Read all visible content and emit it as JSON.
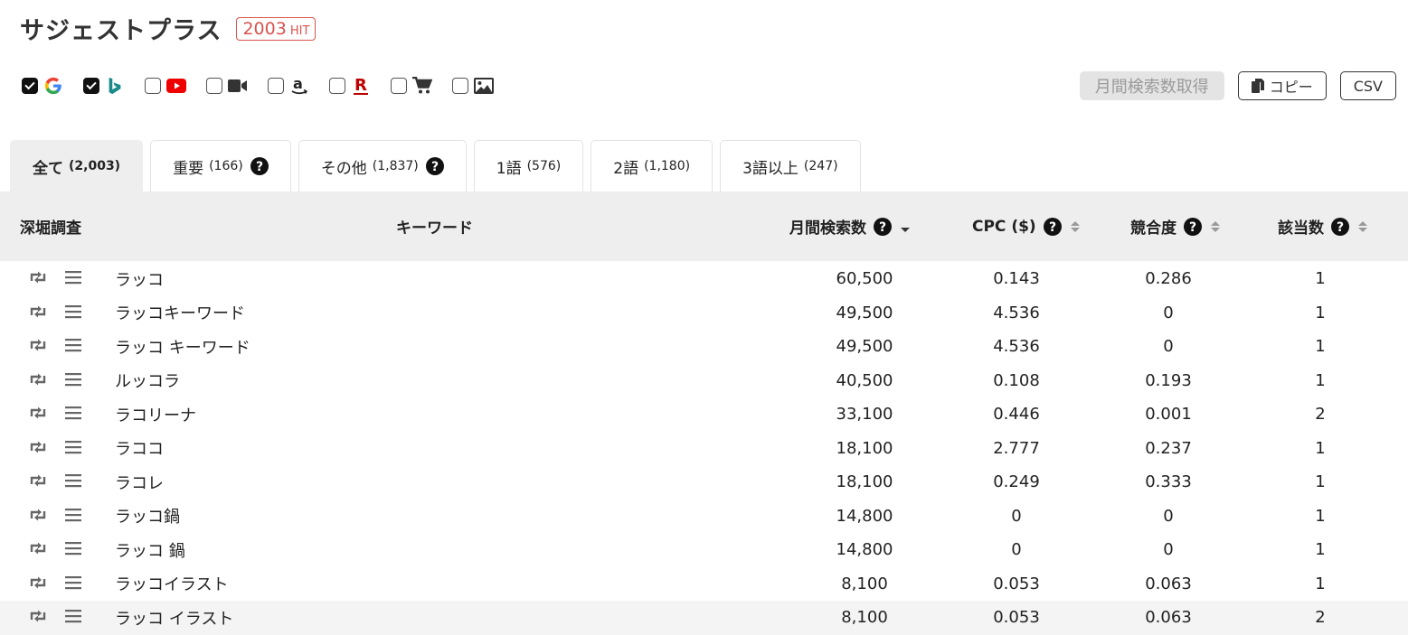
{
  "app": {
    "title": "サジェストプラス",
    "hit_count": "2003",
    "hit_unit": "HIT"
  },
  "sources": [
    {
      "name": "google",
      "icon": "google-icon",
      "checked": true
    },
    {
      "name": "bing",
      "icon": "bing-icon",
      "checked": true
    },
    {
      "name": "youtube",
      "icon": "youtube-icon",
      "checked": false
    },
    {
      "name": "video",
      "icon": "video-camera-icon",
      "checked": false
    },
    {
      "name": "amazon",
      "icon": "amazon-icon",
      "checked": false
    },
    {
      "name": "rakuten",
      "icon": "rakuten-icon",
      "checked": false
    },
    {
      "name": "shopping",
      "icon": "shopping-cart-icon",
      "checked": false
    },
    {
      "name": "image",
      "icon": "image-icon",
      "checked": false
    }
  ],
  "actions": {
    "monthly_search": "月間検索数取得",
    "copy": "コピー",
    "csv": "CSV"
  },
  "tabs": [
    {
      "label": "全て",
      "count": "(2,003)",
      "active": true,
      "help": false
    },
    {
      "label": "重要",
      "count": "(166)",
      "active": false,
      "help": true
    },
    {
      "label": "その他",
      "count": "(1,837)",
      "active": false,
      "help": true
    },
    {
      "label": "1語",
      "count": "(576)",
      "active": false,
      "help": false
    },
    {
      "label": "2語",
      "count": "(1,180)",
      "active": false,
      "help": false
    },
    {
      "label": "3語以上",
      "count": "(247)",
      "active": false,
      "help": false
    }
  ],
  "table": {
    "headers": {
      "deep_dive": "深堀調査",
      "keyword": "キーワード",
      "monthly_search": "月間検索数",
      "cpc": "CPC ($)",
      "competition": "競合度",
      "matches": "該当数"
    },
    "rows": [
      {
        "keyword": "ラッコ",
        "monthly": "60,500",
        "cpc": "0.143",
        "competition": "0.286",
        "matches": "1"
      },
      {
        "keyword": "ラッコキーワード",
        "monthly": "49,500",
        "cpc": "4.536",
        "competition": "0",
        "matches": "1"
      },
      {
        "keyword": "ラッコ キーワード",
        "monthly": "49,500",
        "cpc": "4.536",
        "competition": "0",
        "matches": "1"
      },
      {
        "keyword": "ルッコラ",
        "monthly": "40,500",
        "cpc": "0.108",
        "competition": "0.193",
        "matches": "1"
      },
      {
        "keyword": "ラコリーナ",
        "monthly": "33,100",
        "cpc": "0.446",
        "competition": "0.001",
        "matches": "2"
      },
      {
        "keyword": "ラココ",
        "monthly": "18,100",
        "cpc": "2.777",
        "competition": "0.237",
        "matches": "1"
      },
      {
        "keyword": "ラコレ",
        "monthly": "18,100",
        "cpc": "0.249",
        "competition": "0.333",
        "matches": "1"
      },
      {
        "keyword": "ラッコ鍋",
        "monthly": "14,800",
        "cpc": "0",
        "competition": "0",
        "matches": "1"
      },
      {
        "keyword": "ラッコ 鍋",
        "monthly": "14,800",
        "cpc": "0",
        "competition": "0",
        "matches": "1"
      },
      {
        "keyword": "ラッコイラスト",
        "monthly": "8,100",
        "cpc": "0.053",
        "competition": "0.063",
        "matches": "1"
      },
      {
        "keyword": "ラッコ イラスト",
        "monthly": "8,100",
        "cpc": "0.053",
        "competition": "0.063",
        "matches": "2"
      }
    ]
  }
}
